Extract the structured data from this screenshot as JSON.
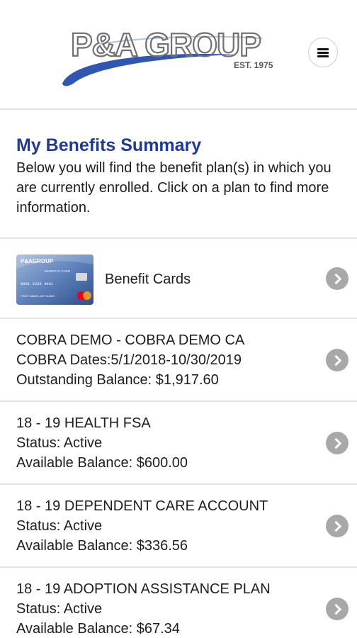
{
  "header": {
    "logo_text": "P&A GROUP",
    "logo_tagline": "EST. 1975",
    "menu_icon": "hamburger-menu-icon"
  },
  "intro": {
    "title": "My Benefits Summary",
    "description": "Below you will find the benefit plan(s) in which you are currently enrolled. Click on a plan to find more information."
  },
  "benefit_cards": {
    "label": "Benefit Cards",
    "card_brand": "P&AGROUP",
    "card_type": "BENEFITS CARD",
    "card_number": "0091 3333 4001",
    "card_name": "FIRST NAME LAST NAME",
    "chevron_icon": "chevron-right-icon"
  },
  "plans": [
    {
      "line1": "COBRA DEMO - COBRA DEMO CA",
      "line2": "COBRA Dates:5/1/2018-10/30/2019",
      "line3": "Outstanding Balance: $1,917.60"
    },
    {
      "line1": "18 - 19 HEALTH FSA",
      "line2": "Status: Active",
      "line3": "Available Balance: $600.00"
    },
    {
      "line1": "18 - 19 DEPENDENT CARE ACCOUNT",
      "line2": "Status: Active",
      "line3": "Available Balance: $336.56"
    },
    {
      "line1": "18 - 19 ADOPTION ASSISTANCE PLAN",
      "line2": "Status: Active",
      "line3": "Available Balance: $67.34"
    }
  ],
  "colors": {
    "title_blue": "#1f3a8f",
    "logo_gray": "#707070",
    "swoosh_blue": "#2f56b0",
    "chevron_gray": "#a8a8a8",
    "divider": "#e3e3e3"
  }
}
